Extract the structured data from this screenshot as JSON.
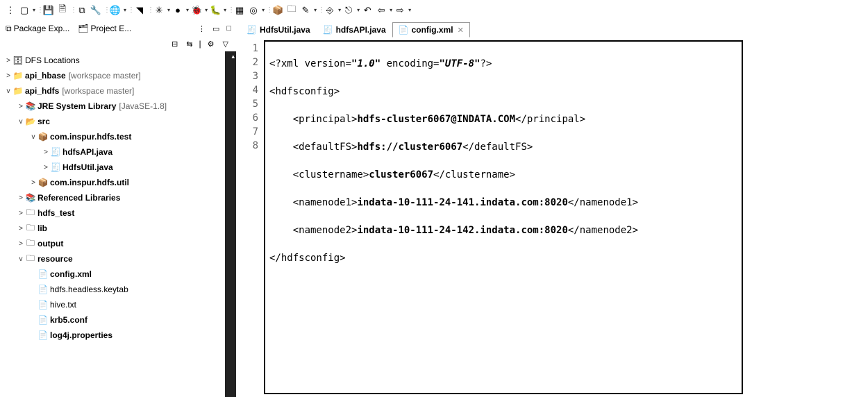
{
  "toolbar": [
    {
      "name": "grip",
      "glyph": "⋮",
      "drop": false
    },
    {
      "name": "new-icon",
      "glyph": "▢",
      "drop": true
    },
    {
      "name": "sep",
      "glyph": "⋮"
    },
    {
      "name": "save-icon",
      "glyph": "💾",
      "drop": false
    },
    {
      "name": "save-all-icon",
      "glyph": "🗎",
      "drop": false
    },
    {
      "name": "sep",
      "glyph": "⋮"
    },
    {
      "name": "toggle-icon",
      "glyph": "⧉",
      "drop": false
    },
    {
      "name": "build-icon",
      "glyph": "🔧",
      "drop": false
    },
    {
      "name": "sep",
      "glyph": "⋮"
    },
    {
      "name": "globe-icon",
      "glyph": "🌐",
      "drop": true
    },
    {
      "name": "sep",
      "glyph": "⋮"
    },
    {
      "name": "tool-icon",
      "glyph": "◥",
      "drop": false
    },
    {
      "name": "sep",
      "glyph": "⋮"
    },
    {
      "name": "gear-icon",
      "glyph": "✳",
      "drop": true
    },
    {
      "name": "play-icon",
      "glyph": "●",
      "drop": true
    },
    {
      "name": "debug-icon",
      "glyph": "🐞",
      "drop": true
    },
    {
      "name": "bug-alt-icon",
      "glyph": "🐛",
      "drop": true
    },
    {
      "name": "sep",
      "glyph": "⋮"
    },
    {
      "name": "grid-icon",
      "glyph": "▦",
      "drop": false
    },
    {
      "name": "stop-icon",
      "glyph": "◎",
      "drop": true
    },
    {
      "name": "sep",
      "glyph": "⋮"
    },
    {
      "name": "package-icon",
      "glyph": "📦",
      "drop": false
    },
    {
      "name": "type-icon",
      "glyph": "🗀",
      "drop": false
    },
    {
      "name": "wand-icon",
      "glyph": "✎",
      "drop": true
    },
    {
      "name": "sep",
      "glyph": "⋮"
    },
    {
      "name": "task-icon",
      "glyph": "⎆",
      "drop": true
    },
    {
      "name": "task-alt-icon",
      "glyph": "⎋",
      "drop": true
    },
    {
      "name": "undo-icon",
      "glyph": "↶",
      "drop": false
    },
    {
      "name": "back-icon",
      "glyph": "⇦",
      "drop": true
    },
    {
      "name": "fwd-icon",
      "glyph": "⇨",
      "drop": true
    }
  ],
  "views": {
    "tab1": "Package Exp...",
    "tab2": "Project E..."
  },
  "tree": [
    {
      "depth": 0,
      "exp": ">",
      "ico": "🗄",
      "label": "DFS Locations",
      "bold": false
    },
    {
      "depth": 0,
      "exp": ">",
      "ico": "📁",
      "label": "api_hbase",
      "suffix": "[workspace master]",
      "bold": true
    },
    {
      "depth": 0,
      "exp": "v",
      "ico": "📁",
      "label": "api_hdfs",
      "suffix": "[workspace master]",
      "bold": true
    },
    {
      "depth": 1,
      "exp": ">",
      "ico": "📚",
      "label": "JRE System Library",
      "suffix": "[JavaSE-1.8]",
      "bold": true
    },
    {
      "depth": 1,
      "exp": "v",
      "ico": "📂",
      "label": "src",
      "bold": true
    },
    {
      "depth": 2,
      "exp": "v",
      "ico": "📦",
      "label": "com.inspur.hdfs.test",
      "bold": true
    },
    {
      "depth": 3,
      "exp": ">",
      "ico": "🧾",
      "label": "hdfsAPI.java",
      "bold": true
    },
    {
      "depth": 3,
      "exp": ">",
      "ico": "🧾",
      "label": "HdfsUtil.java",
      "bold": true
    },
    {
      "depth": 2,
      "exp": ">",
      "ico": "📦",
      "label": "com.inspur.hdfs.util",
      "bold": true
    },
    {
      "depth": 1,
      "exp": ">",
      "ico": "📚",
      "label": "Referenced Libraries",
      "bold": true
    },
    {
      "depth": 1,
      "exp": ">",
      "ico": "🗀",
      "label": "hdfs_test",
      "bold": true
    },
    {
      "depth": 1,
      "exp": ">",
      "ico": "🗀",
      "label": "lib",
      "bold": true
    },
    {
      "depth": 1,
      "exp": ">",
      "ico": "🗀",
      "label": "output",
      "bold": true
    },
    {
      "depth": 1,
      "exp": "v",
      "ico": "🗀",
      "label": "resource",
      "bold": true
    },
    {
      "depth": 2,
      "exp": "",
      "ico": "📄",
      "label": "config.xml",
      "bold": true
    },
    {
      "depth": 2,
      "exp": "",
      "ico": "📄",
      "label": "hdfs.headless.keytab",
      "bold": false
    },
    {
      "depth": 2,
      "exp": "",
      "ico": "📄",
      "label": "hive.txt",
      "bold": false
    },
    {
      "depth": 2,
      "exp": "",
      "ico": "📄",
      "label": "krb5.conf",
      "bold": true
    },
    {
      "depth": 2,
      "exp": "",
      "ico": "📄",
      "label": "log4j.properties",
      "bold": true
    }
  ],
  "editorTabs": [
    {
      "ico": "🧾",
      "label": "HdfsUtil.java",
      "active": false,
      "close": false
    },
    {
      "ico": "🧾",
      "label": "hdfsAPI.java",
      "active": false,
      "close": false
    },
    {
      "ico": "📄",
      "label": "config.xml",
      "active": true,
      "close": true
    }
  ],
  "code": {
    "lines": [
      1,
      2,
      3,
      4,
      5,
      6,
      7,
      8
    ],
    "xml": {
      "version": "1.0",
      "encoding": "UTF-8",
      "root": "hdfsconfig",
      "principal": "hdfs-cluster6067@INDATA.COM",
      "defaultFS": "hdfs://cluster6067",
      "clustername": "cluster6067",
      "namenode1": "indata-10-111-24-141.indata.com:8020",
      "namenode2": "indata-10-111-24-142.indata.com:8020"
    }
  }
}
